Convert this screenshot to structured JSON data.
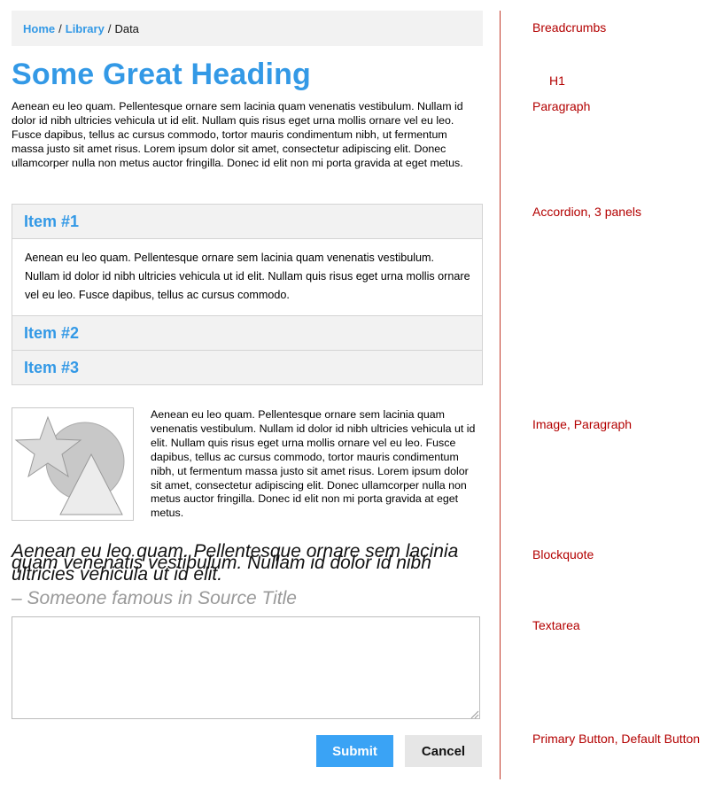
{
  "breadcrumbs": {
    "items": [
      {
        "label": "Home"
      },
      {
        "label": "Library"
      }
    ],
    "separator": "/",
    "current": "Data"
  },
  "heading": "Some Great Heading",
  "paragraph": "Aenean eu leo quam. Pellentesque ornare sem lacinia quam venenatis vestibulum. Nullam id dolor id nibh ultricies vehicula ut id elit. Nullam quis risus eget urna mollis ornare vel eu leo. Fusce dapibus, tellus ac cursus commodo, tortor mauris condimentum nibh, ut fermentum massa justo sit amet risus. Lorem ipsum dolor sit amet, consectetur adipiscing elit. Donec ullamcorper nulla non metus auctor fringilla. Donec id elit non mi porta gravida at eget metus.",
  "accordion": {
    "panels": [
      {
        "title": "Item #1",
        "expanded": true,
        "body": "Aenean eu leo quam. Pellentesque ornare sem lacinia quam venenatis vestibulum. Nullam id dolor id nibh ultricies vehicula ut id elit. Nullam quis risus eget urna mollis ornare vel eu leo. Fusce dapibus, tellus ac cursus commodo."
      },
      {
        "title": "Item #2",
        "expanded": false
      },
      {
        "title": "Item #3",
        "expanded": false
      }
    ]
  },
  "media": {
    "image_icon": "image-placeholder-icon",
    "text": "Aenean eu leo quam. Pellentesque ornare sem lacinia quam venenatis vestibulum. Nullam id dolor id nibh ultricies vehicula ut id elit. Nullam quis risus eget urna mollis ornare vel eu leo. Fusce dapibus, tellus ac cursus commodo, tortor mauris condimentum nibh, ut fermentum massa justo sit amet risus. Lorem ipsum dolor sit amet, consectetur adipiscing elit. Donec ullamcorper nulla non metus auctor fringilla. Donec id elit non mi porta gravida at eget metus."
  },
  "blockquote": {
    "text": "Aenean eu leo quam. Pellentesque ornare sem lacinia quam venenatis vestibulum. Nullam id dolor id nibh ultricies vehicula ut id elit.",
    "cite": "– Someone famous in Source Title"
  },
  "textarea": {
    "value": ""
  },
  "buttons": {
    "submit": "Submit",
    "cancel": "Cancel"
  },
  "annotations": {
    "breadcrumbs": "Breadcrumbs",
    "h1": "H1",
    "paragraph": "Paragraph",
    "accordion": "Accordion, 3 panels",
    "image_paragraph": "Image, Paragraph",
    "blockquote": "Blockquote",
    "textarea": "Textarea",
    "buttons": "Primary Button, Default Button"
  },
  "colors": {
    "accent": "#3399e6",
    "annotation": "#b30000",
    "panel_bg": "#f2f2f2",
    "primary_button": "#3aa3f5"
  }
}
